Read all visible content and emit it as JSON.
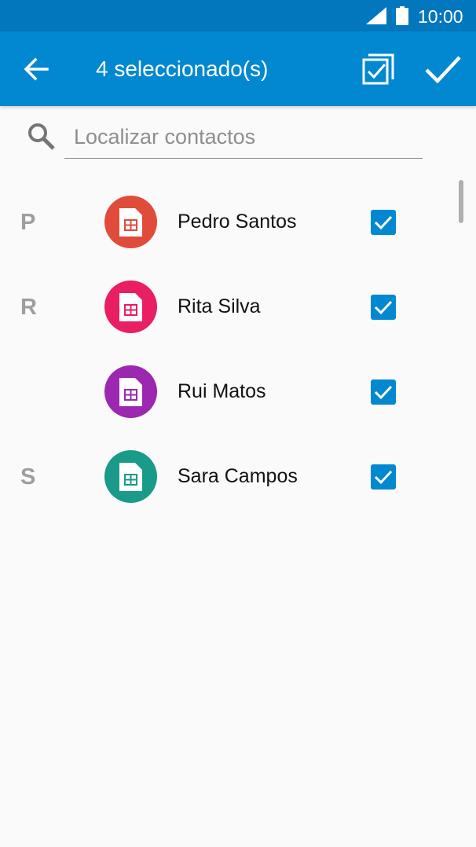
{
  "status_bar": {
    "time": "10:00"
  },
  "app_bar": {
    "title": "4 seleccionado(s)",
    "back_icon": "arrow-back-icon",
    "select_all_icon": "select-all-icon",
    "done_icon": "check-icon"
  },
  "search": {
    "placeholder": "Localizar contactos",
    "value": ""
  },
  "contacts": [
    {
      "section": "P",
      "name": "Pedro Santos",
      "avatar_color": "#e04b3a",
      "checked": true
    },
    {
      "section": "R",
      "name": "Rita Silva",
      "avatar_color": "#e91e63",
      "checked": true
    },
    {
      "section": "",
      "name": "Rui Matos",
      "avatar_color": "#9c27b0",
      "checked": true
    },
    {
      "section": "S",
      "name": "Sara Campos",
      "avatar_color": "#1a9a88",
      "checked": true
    }
  ],
  "colors": {
    "status_bar": "#0277bd",
    "app_bar": "#0288d1",
    "checkbox": "#0288d1"
  }
}
